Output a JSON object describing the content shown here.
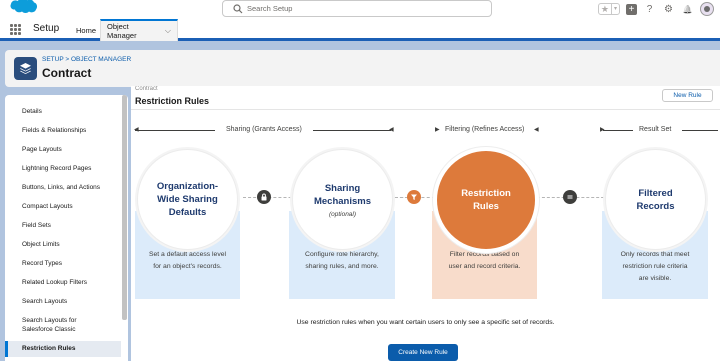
{
  "global_header": {
    "search_placeholder": "Search Setup",
    "fav_star": "★",
    "fav_chevron": "▾",
    "add_symbol": "+",
    "help_symbol": "?",
    "gear_symbol": "⚙",
    "bell_symbol": "🔔"
  },
  "nav": {
    "app_name": "Setup",
    "tabs": [
      {
        "label": "Home"
      },
      {
        "label": "Object Manager",
        "chevron": "⌵"
      }
    ]
  },
  "page_header": {
    "breadcrumb": "SETUP > OBJECT MANAGER",
    "title": "Contract"
  },
  "sidebar": {
    "items": [
      {
        "label": "Details"
      },
      {
        "label": "Fields & Relationships"
      },
      {
        "label": "Page Layouts"
      },
      {
        "label": "Lightning Record Pages"
      },
      {
        "label": "Buttons, Links, and Actions"
      },
      {
        "label": "Compact Layouts"
      },
      {
        "label": "Field Sets"
      },
      {
        "label": "Object Limits"
      },
      {
        "label": "Record Types"
      },
      {
        "label": "Related Lookup Filters"
      },
      {
        "label": "Search Layouts"
      },
      {
        "label": "Search Layouts for Salesforce Classic"
      },
      {
        "label": "Restriction Rules"
      }
    ],
    "active_index": 12
  },
  "main": {
    "cut_label": "Contract",
    "title": "Restriction Rules",
    "new_rule_button": "New Rule",
    "sections": [
      {
        "label": "Sharing (Grants Access)"
      },
      {
        "label": "Filtering (Refines Access)"
      },
      {
        "label": "Result Set"
      }
    ],
    "steps": [
      {
        "title_line1": "Organization-",
        "title_line2": "Wide Sharing",
        "title_line3": "Defaults",
        "desc_line1": "Set a default access level",
        "desc_line2": "for an object's records.",
        "desc_line3": ""
      },
      {
        "title_line1": "Sharing",
        "title_line2": "Mechanisms",
        "subtitle": "(optional)",
        "desc_line1": "Configure role hierarchy,",
        "desc_line2": "sharing rules, and more.",
        "desc_line3": ""
      },
      {
        "title_line1": "Restriction",
        "title_line2": "Rules",
        "desc_line1": "Filter records based on",
        "desc_line2": "user and record criteria.",
        "desc_line3": ""
      },
      {
        "title_line1": "Filtered",
        "title_line2": "Records",
        "desc_line1": "Only records that meet",
        "desc_line2": "restriction rule criteria",
        "desc_line3": "are visible."
      }
    ],
    "helper_text": "Use restriction rules when you want certain users to only see a specific set of records.",
    "create_button": "Create New Rule"
  },
  "colors": {
    "brand_blue": "#0b5cab",
    "restriction_orange": "#dd7a3b",
    "card_blue": "#dcebfa",
    "card_orange": "#f8dccb"
  }
}
